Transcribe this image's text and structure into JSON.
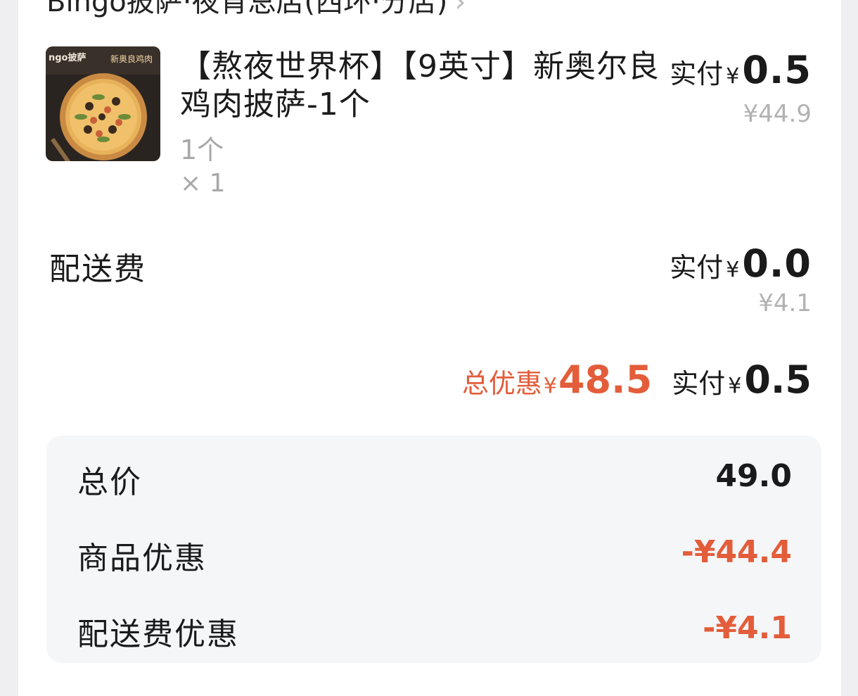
{
  "store": {
    "name": "Bingo披萨·夜宵总店(西环·分店)",
    "chevron": "›"
  },
  "product": {
    "title": "【熬夜世界杯】【9英寸】新奥尔良鸡肉披萨-1个",
    "spec": "1个",
    "qty": "× 1",
    "thumb_text_left": "ngo披萨",
    "thumb_text_right": "新奥良鸡肉",
    "pay_label": "实付",
    "pay_yen": "¥",
    "pay_amount": "0.5",
    "original_price": "¥44.9"
  },
  "delivery": {
    "label": "配送费",
    "pay_label": "实付",
    "pay_yen": "¥",
    "pay_amount": "0.0",
    "original_price": "¥4.1"
  },
  "summary": {
    "discount_label": "总优惠",
    "discount_yen": "¥",
    "discount_amount": "48.5",
    "pay_label": "实付",
    "pay_yen": "¥",
    "pay_amount": "0.5"
  },
  "breakdown": [
    {
      "label": "总价",
      "value": "49.0"
    },
    {
      "label": "商品优惠",
      "value": "-¥44.4"
    },
    {
      "label": "配送费优惠",
      "value": "-¥4.1"
    }
  ],
  "colors": {
    "accent_red": "#e35d3a",
    "text_dark": "#1a1a1a",
    "text_gray": "#a8a8a8",
    "panel_bg": "#f5f6f8"
  }
}
